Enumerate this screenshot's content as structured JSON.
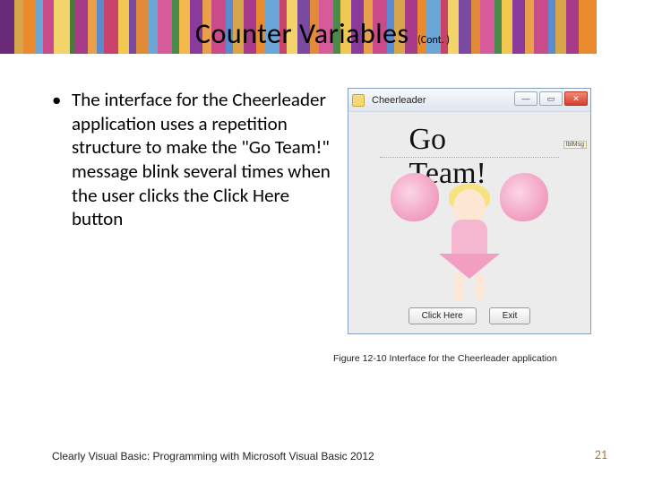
{
  "title": {
    "main": "Counter Variables",
    "cont": "(Cont. )"
  },
  "bullet": {
    "dot": "•",
    "text": "The interface for the Cheerleader application uses a repetition structure to make the \"Go Team!\" message blink several times when the user clicks the Click Here button"
  },
  "app_window": {
    "title": "Cheerleader",
    "min_glyph": "—",
    "max_glyph": "▭",
    "close_glyph": "✕",
    "message": "Go Team!",
    "label_handle": "lblMsg",
    "buttons": {
      "click_here": "Click Here",
      "exit": "Exit"
    }
  },
  "figure_caption": "Figure 12-10 Interface for the Cheerleader application",
  "footer": {
    "left": "Clearly Visual Basic: Programming with Microsoft Visual Basic 2012",
    "page": "21"
  },
  "stripes": [
    {
      "w": 16,
      "c": "#6a2a7a"
    },
    {
      "w": 10,
      "c": "#d7a64a"
    },
    {
      "w": 14,
      "c": "#e98a2e"
    },
    {
      "w": 8,
      "c": "#6aa6d6"
    },
    {
      "w": 12,
      "c": "#c94b8a"
    },
    {
      "w": 18,
      "c": "#f3d46a"
    },
    {
      "w": 6,
      "c": "#4a7a3a"
    },
    {
      "w": 14,
      "c": "#a83a8a"
    },
    {
      "w": 10,
      "c": "#e9a04a"
    },
    {
      "w": 8,
      "c": "#5a8ad0"
    },
    {
      "w": 16,
      "c": "#c9426a"
    },
    {
      "w": 12,
      "c": "#f0c850"
    },
    {
      "w": 8,
      "c": "#7a4aa0"
    },
    {
      "w": 14,
      "c": "#e08a3a"
    },
    {
      "w": 10,
      "c": "#6aa6d6"
    },
    {
      "w": 16,
      "c": "#d75a9a"
    },
    {
      "w": 8,
      "c": "#4a8a4a"
    },
    {
      "w": 12,
      "c": "#f3b84a"
    },
    {
      "w": 14,
      "c": "#8a3a9a"
    },
    {
      "w": 10,
      "c": "#e9a04a"
    },
    {
      "w": 16,
      "c": "#c94b8a"
    },
    {
      "w": 8,
      "c": "#5a8ad0"
    },
    {
      "w": 12,
      "c": "#d7a64a"
    },
    {
      "w": 14,
      "c": "#a83a8a"
    },
    {
      "w": 10,
      "c": "#e98a2e"
    },
    {
      "w": 16,
      "c": "#6aa6d6"
    },
    {
      "w": 8,
      "c": "#c9426a"
    },
    {
      "w": 12,
      "c": "#f3d46a"
    },
    {
      "w": 14,
      "c": "#7a4aa0"
    },
    {
      "w": 10,
      "c": "#e08a3a"
    },
    {
      "w": 16,
      "c": "#d75a9a"
    },
    {
      "w": 8,
      "c": "#4a8a4a"
    },
    {
      "w": 12,
      "c": "#f0c850"
    },
    {
      "w": 14,
      "c": "#8a3a9a"
    },
    {
      "w": 10,
      "c": "#e9a04a"
    },
    {
      "w": 16,
      "c": "#c94b8a"
    },
    {
      "w": 8,
      "c": "#5a8ad0"
    },
    {
      "w": 12,
      "c": "#d7a64a"
    },
    {
      "w": 14,
      "c": "#a83a8a"
    },
    {
      "w": 10,
      "c": "#e98a2e"
    },
    {
      "w": 16,
      "c": "#6aa6d6"
    },
    {
      "w": 8,
      "c": "#c9426a"
    },
    {
      "w": 12,
      "c": "#f3d46a"
    },
    {
      "w": 14,
      "c": "#7a4aa0"
    },
    {
      "w": 10,
      "c": "#e08a3a"
    },
    {
      "w": 16,
      "c": "#d75a9a"
    },
    {
      "w": 8,
      "c": "#4a8a4a"
    },
    {
      "w": 12,
      "c": "#f0c850"
    },
    {
      "w": 14,
      "c": "#8a3a9a"
    },
    {
      "w": 10,
      "c": "#e9a04a"
    },
    {
      "w": 16,
      "c": "#c94b8a"
    },
    {
      "w": 8,
      "c": "#5a8ad0"
    },
    {
      "w": 12,
      "c": "#d7a64a"
    },
    {
      "w": 14,
      "c": "#a83a8a"
    },
    {
      "w": 20,
      "c": "#e98a2e"
    }
  ]
}
